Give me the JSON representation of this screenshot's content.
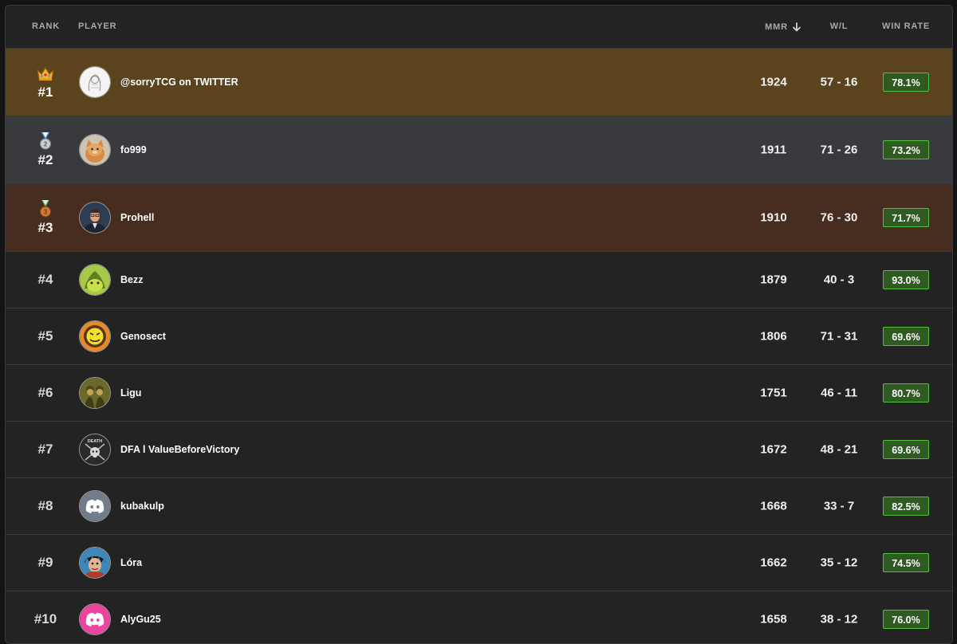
{
  "header": {
    "rank": "RANK",
    "player": "PLAYER",
    "mmr": "MMR",
    "wl": "W/L",
    "winrate": "WIN RATE"
  },
  "colors": {
    "gold_row": "#5b431d",
    "silver_row": "#383a3e",
    "bronze_row": "#472d20",
    "winrate_badge_bg": "#2f5a22",
    "winrate_badge_border": "#52c23e"
  },
  "rows": [
    {
      "rank": "#1",
      "icon": "crown-icon",
      "avatar": "sketch-avatar",
      "name": "@sorryTCG on TWITTER",
      "mmr": "1924",
      "wl": "57 - 16",
      "winrate": "78.1%"
    },
    {
      "rank": "#2",
      "icon": "silver-medal-icon",
      "avatar": "cat-avatar",
      "name": "fo999",
      "mmr": "1911",
      "wl": "71 - 26",
      "winrate": "73.2%"
    },
    {
      "rank": "#3",
      "icon": "bronze-medal-icon",
      "avatar": "man-portrait-avatar",
      "name": "Prohell",
      "mmr": "1910",
      "wl": "76 - 30",
      "winrate": "71.7%"
    },
    {
      "rank": "#4",
      "avatar": "green-creature-avatar",
      "name": "Bezz",
      "mmr": "1879",
      "wl": "40 - 3",
      "winrate": "93.0%"
    },
    {
      "rank": "#5",
      "avatar": "yellow-face-avatar",
      "name": "Genosect",
      "mmr": "1806",
      "wl": "71 - 31",
      "winrate": "69.6%"
    },
    {
      "rank": "#6",
      "avatar": "soldiers-avatar",
      "name": "Ligu",
      "mmr": "1751",
      "wl": "46 - 11",
      "winrate": "80.7%"
    },
    {
      "rank": "#7",
      "avatar": "death-skull-avatar",
      "avatar_text": "DEATH",
      "name": "DFA l ValueBeforeVictory",
      "mmr": "1672",
      "wl": "48 - 21",
      "winrate": "69.6%"
    },
    {
      "rank": "#8",
      "avatar": "discord-gray-avatar",
      "name": "kubakulp",
      "mmr": "1668",
      "wl": "33 - 7",
      "winrate": "82.5%"
    },
    {
      "rank": "#9",
      "avatar": "anime-character-avatar",
      "name": "Lóra",
      "mmr": "1662",
      "wl": "35 - 12",
      "winrate": "74.5%"
    },
    {
      "rank": "#10",
      "avatar": "discord-pink-avatar",
      "name": "AlyGu25",
      "mmr": "1658",
      "wl": "38 - 12",
      "winrate": "76.0%"
    }
  ]
}
